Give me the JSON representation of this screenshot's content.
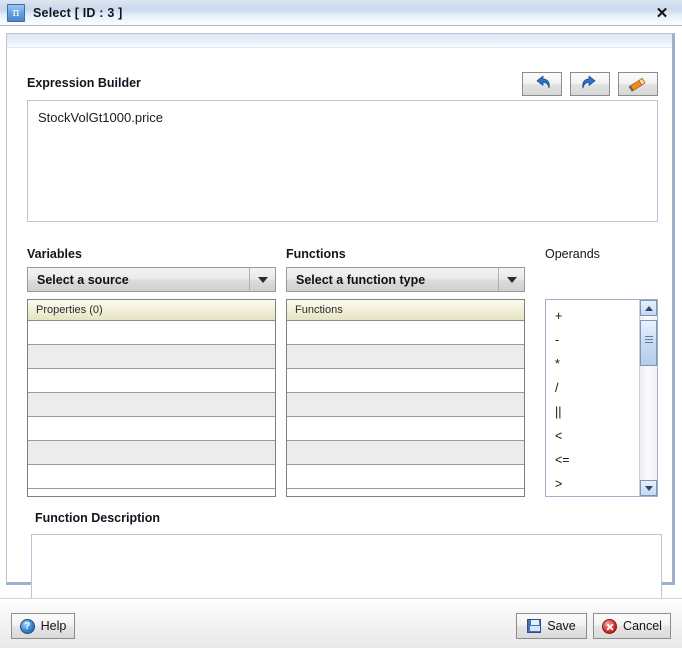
{
  "window": {
    "title": "Select [ ID : 3 ]",
    "icon": "pi-icon",
    "close_label": "✕"
  },
  "expression_builder": {
    "label": "Expression Builder",
    "value": "StockVolGt1000.price",
    "placeholder": ""
  },
  "toolbar": {
    "buttons": [
      {
        "name": "undo-button",
        "icon": "undo-arrow-icon",
        "label": ""
      },
      {
        "name": "redo-button",
        "icon": "redo-arrow-icon",
        "label": ""
      },
      {
        "name": "clear-button",
        "icon": "eraser-pencil-icon",
        "label": ""
      }
    ]
  },
  "variables": {
    "label": "Variables",
    "source_select": {
      "selected": "Select a source",
      "options": [
        "Select a source"
      ]
    },
    "list_header": "Properties (0)",
    "rows": [
      "",
      "",
      "",
      "",
      "",
      "",
      ""
    ]
  },
  "functions": {
    "label": "Functions",
    "type_select": {
      "selected": "Select a function type",
      "options": [
        "Select a function type"
      ]
    },
    "list_header": "Functions",
    "rows": [
      "",
      "",
      "",
      "",
      "",
      "",
      ""
    ]
  },
  "operands": {
    "label": "Operands",
    "items": [
      "+",
      "-",
      "*",
      "/",
      "||",
      "<",
      "<=",
      ">"
    ]
  },
  "function_description": {
    "label": "Function Description",
    "value": ""
  },
  "footer": {
    "help_label": "Help",
    "save_label": "Save",
    "cancel_label": "Cancel"
  },
  "colors": {
    "titlebar_accent": "#c9d8ec",
    "panel_border": "#b9c4d6",
    "list_header": "#f2efd9",
    "scrollbar_thumb": "#c9dbf2",
    "cancel_red": "#d02b2b",
    "save_blue": "#3f72b8"
  }
}
